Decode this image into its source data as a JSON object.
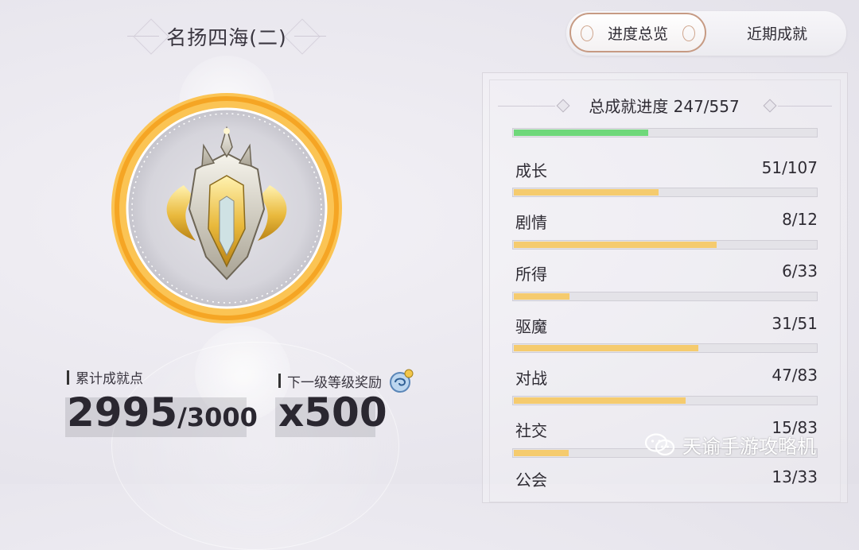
{
  "title": "名扬四海(二)",
  "stats": {
    "points_label": "累计成就点",
    "points_current": "2995",
    "points_total": "/3000",
    "reward_label": "下一级等级奖励",
    "reward_amount": "x500",
    "reward_icon": "coin-bag-icon"
  },
  "tabs": [
    {
      "label": "进度总览",
      "active": true
    },
    {
      "label": "近期成就",
      "active": false
    }
  ],
  "total": {
    "label": "总成就进度 247/557",
    "current": 247,
    "max": 557,
    "bar_color": "#6fd87a"
  },
  "categories": [
    {
      "label": "成长",
      "value": "51/107",
      "fraction": 0.476
    },
    {
      "label": "剧情",
      "value": "8/12",
      "fraction": 0.667
    },
    {
      "label": "所得",
      "value": "6/33",
      "fraction": 0.182
    },
    {
      "label": "驱魔",
      "value": "31/51",
      "fraction": 0.608
    },
    {
      "label": "对战",
      "value": "47/83",
      "fraction": 0.566
    },
    {
      "label": "社交",
      "value": "15/83",
      "fraction": 0.181
    },
    {
      "label": "公会",
      "value": "13/33",
      "fraction": 0.394
    }
  ],
  "colors": {
    "category_fill": "#f5cb6e",
    "ring": "#f7b23b",
    "tab_border": "#c69a83"
  },
  "watermark": {
    "text": "天谕手游攻略机",
    "icon": "wechat-icon"
  }
}
